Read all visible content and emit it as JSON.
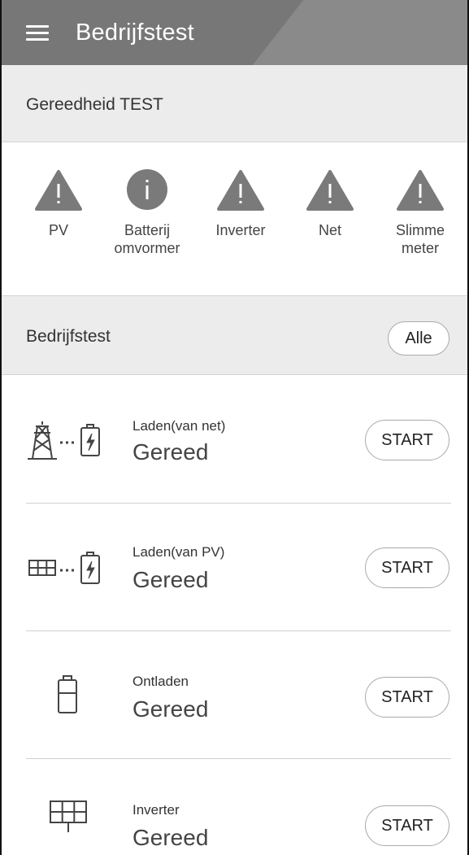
{
  "header": {
    "title": "Bedrijfstest"
  },
  "readiness": {
    "title": "Gereedheid TEST",
    "items": [
      {
        "label_line1": "PV",
        "label_line2": "",
        "icon": "warning-icon"
      },
      {
        "label_line1": "Batterij",
        "label_line2": "omvormer",
        "icon": "info-icon"
      },
      {
        "label_line1": "Inverter",
        "label_line2": "",
        "icon": "warning-icon"
      },
      {
        "label_line1": "Net",
        "label_line2": "",
        "icon": "warning-icon"
      },
      {
        "label_line1": "Slimme",
        "label_line2": "meter",
        "icon": "warning-icon"
      }
    ]
  },
  "operation": {
    "title": "Bedrijfstest",
    "all_button": "Alle",
    "tests": [
      {
        "title": "Laden(van net)",
        "status": "Gereed",
        "button": "START",
        "icon": "grid-to-battery-icon"
      },
      {
        "title": "Laden(van PV)",
        "status": "Gereed",
        "button": "START",
        "icon": "pv-to-battery-icon"
      },
      {
        "title": "Ontladen",
        "status": "Gereed",
        "button": "START",
        "icon": "battery-icon"
      },
      {
        "title": "Inverter",
        "status": "Gereed",
        "button": "START",
        "icon": "solar-panel-icon"
      }
    ]
  },
  "colors": {
    "header_bg": "#777777",
    "section_bg": "#ececec",
    "icon_gray": "#7a7a7a"
  }
}
